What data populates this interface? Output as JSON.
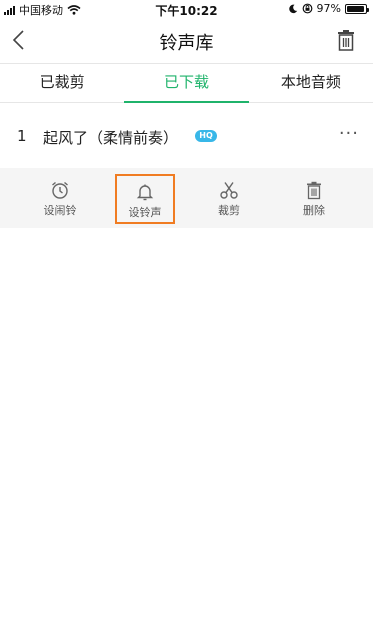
{
  "status_bar": {
    "carrier": "中国移动",
    "time": "下午10:22",
    "battery_percent": "97%",
    "battery_level": 0.97
  },
  "header": {
    "title": "铃声库"
  },
  "tabs": [
    {
      "label": "已裁剪",
      "active": false
    },
    {
      "label": "已下载",
      "active": true
    },
    {
      "label": "本地音频",
      "active": false
    }
  ],
  "song": {
    "index": "1",
    "title": "起风了（柔情前奏）",
    "badge": "HQ",
    "more": "···"
  },
  "actions": [
    {
      "label": "设闹铃",
      "icon": "alarm-clock-icon"
    },
    {
      "label": "设铃声",
      "icon": "bell-icon",
      "highlighted": true
    },
    {
      "label": "裁剪",
      "icon": "scissors-icon"
    },
    {
      "label": "删除",
      "icon": "trash-icon"
    }
  ],
  "colors": {
    "accent": "#1fb36b",
    "highlight_border": "#f07c22",
    "hq_badge": "#38b7e8"
  }
}
